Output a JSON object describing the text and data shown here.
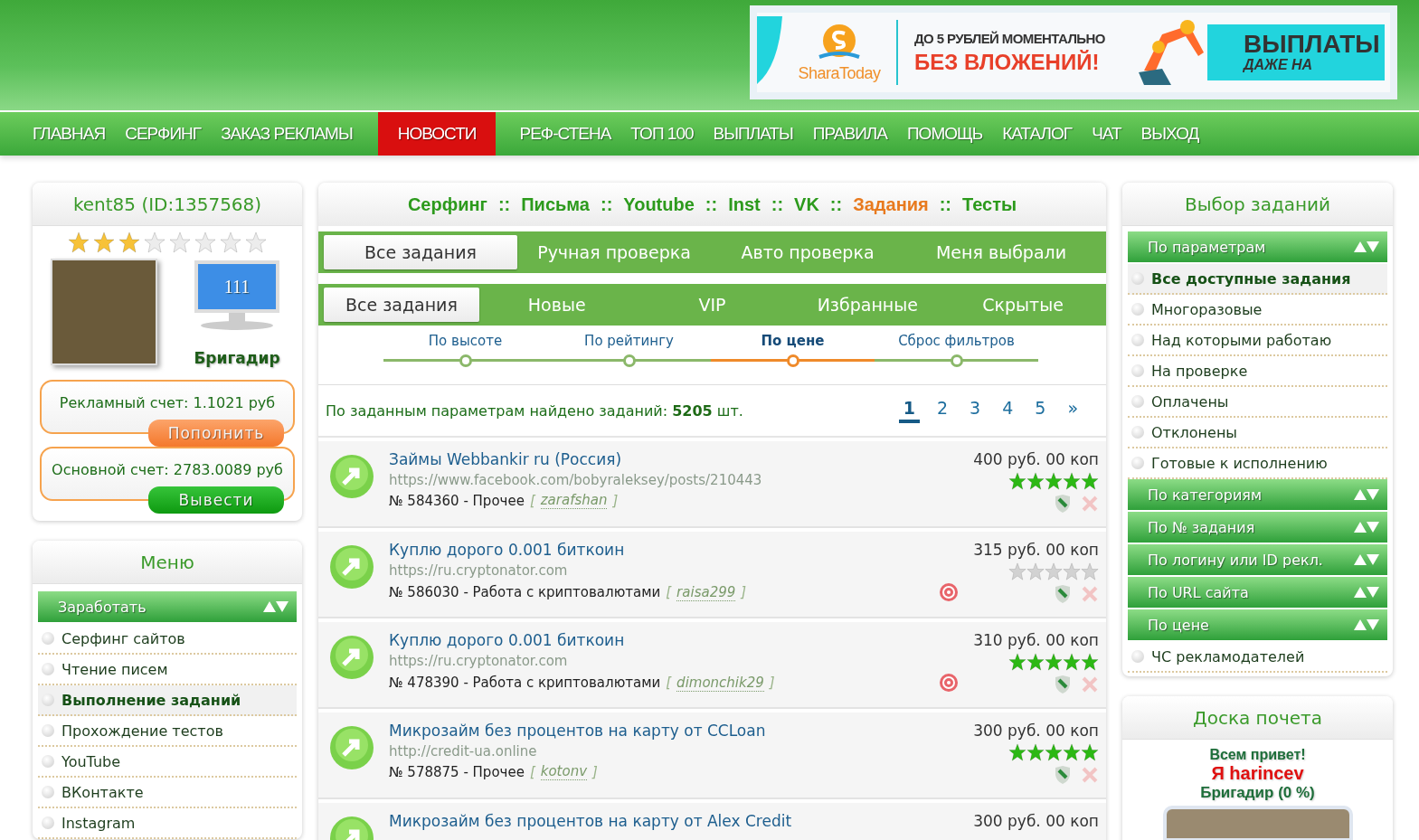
{
  "banner": {
    "logo": "SharaToday",
    "line_1": "ДО 5 РУБЛЕЙ МОМЕНТАЛЬНО",
    "line_2": "БЕЗ ВЛОЖЕНИЙ!",
    "headline": "ВЫПЛАТЫ",
    "subline": "ДАЖЕ НА"
  },
  "nav": [
    {
      "label": "ГЛАВНАЯ",
      "selected": false
    },
    {
      "label": "СЕРФИНГ",
      "selected": false
    },
    {
      "label": "ЗАКАЗ РЕКЛАМЫ",
      "selected": false
    },
    {
      "label": "НОВОСТИ",
      "selected": true
    },
    {
      "label": "РЕФ-СТЕНА",
      "selected": false
    },
    {
      "label": "ТОП 100",
      "selected": false
    },
    {
      "label": "ВЫПЛАТЫ",
      "selected": false
    },
    {
      "label": "ПРАВИЛА",
      "selected": false
    },
    {
      "label": "ПОМОЩЬ",
      "selected": false
    },
    {
      "label": "КАТАЛОГ",
      "selected": false
    },
    {
      "label": "ЧАТ",
      "selected": false
    },
    {
      "label": "ВЫХОД",
      "selected": false
    }
  ],
  "profile": {
    "title": "kent85 (ID:1357568)",
    "stars": 3,
    "level": "111",
    "rank": "Бригадир",
    "accounts": [
      {
        "label": "Рекламный счет: 1.1021 руб",
        "button": "Пополнить",
        "kind": "topup"
      },
      {
        "label": "Основной счет: 2783.0089 руб",
        "button": "Вывести",
        "kind": "withdraw"
      }
    ]
  },
  "menu": {
    "title": "Меню",
    "section": "Заработать",
    "items": [
      {
        "label": "Серфинг сайтов",
        "selected": false
      },
      {
        "label": "Чтение писем",
        "selected": false
      },
      {
        "label": "Выполнение заданий",
        "selected": true
      },
      {
        "label": "Прохождение тестов",
        "selected": false
      },
      {
        "label": "YouTube",
        "selected": false
      },
      {
        "label": "ВКонтакте",
        "selected": false
      },
      {
        "label": "Instagram",
        "selected": false
      }
    ]
  },
  "top_links": {
    "separator": "::",
    "items": [
      {
        "label": "Серфинг",
        "selected": false
      },
      {
        "label": "Письма",
        "selected": false
      },
      {
        "label": "Youtube",
        "selected": false
      },
      {
        "label": "Inst",
        "selected": false
      },
      {
        "label": "VK",
        "selected": false
      },
      {
        "label": "Задания",
        "selected": true
      },
      {
        "label": "Тесты",
        "selected": false
      }
    ]
  },
  "check_tabs": [
    {
      "label": "Все задания",
      "selected": true
    },
    {
      "label": "Ручная проверка",
      "selected": false
    },
    {
      "label": "Авто проверка",
      "selected": false
    },
    {
      "label": "Меня выбрали",
      "selected": false
    }
  ],
  "type_tabs": [
    {
      "label": "Все задания",
      "selected": true
    },
    {
      "label": "Новые",
      "selected": false
    },
    {
      "label": "VIP",
      "selected": false
    },
    {
      "label": "Избранные",
      "selected": false
    },
    {
      "label": "Скрытые",
      "selected": false
    }
  ],
  "sort": [
    {
      "label": "По высоте",
      "selected": false
    },
    {
      "label": "По рейтингу",
      "selected": false
    },
    {
      "label": "По цене",
      "selected": true
    },
    {
      "label": "Сброс фильтров",
      "selected": false
    }
  ],
  "found_text": "По заданным параметрам найдено заданий: **5205** шт.",
  "pages": [
    {
      "label": "1",
      "selected": true
    },
    {
      "label": "2",
      "selected": false
    },
    {
      "label": "3",
      "selected": false
    },
    {
      "label": "4",
      "selected": false
    },
    {
      "label": "5",
      "selected": false
    },
    {
      "label": "»",
      "selected": false
    }
  ],
  "author_open": "[",
  "author_close": "]",
  "tasks": [
    {
      "title": "Займы Webbankir ru (Россия)",
      "url": "https://www.facebook.com/bobyraleksey/posts/210443",
      "meta": "№ 584360 - Прочее",
      "author": "zarafshan",
      "price": "400 руб. 00 коп",
      "stars": 5,
      "target": false
    },
    {
      "title": "Куплю дорого 0.001 биткоин",
      "url": "https://ru.cryptonator.com",
      "meta": "№ 586030 - Работа с криптовалютами",
      "author": "raisa299",
      "price": "315 руб. 00 коп",
      "stars": 0,
      "target": true
    },
    {
      "title": "Куплю дорого 0.001 биткоин",
      "url": "https://ru.cryptonator.com",
      "meta": "№ 478390 - Работа с криптовалютами",
      "author": "dimonchik29",
      "price": "310 руб. 00 коп",
      "stars": 5,
      "target": true
    },
    {
      "title": "Микрозайм без процентов на карту от CCLoan",
      "url": "http://credit-ua.online",
      "meta": "№ 578875 - Прочее",
      "author": "kotonv",
      "price": "300 руб. 00 коп",
      "stars": 5,
      "target": false
    },
    {
      "title": "Микрозайм без процентов на карту от Alex Credit",
      "price": "300 руб. 00 коп"
    }
  ],
  "filters": {
    "title": "Выбор заданий",
    "rows": [
      {
        "kind": "header",
        "label": "По параметрам"
      },
      {
        "kind": "item",
        "label": "Все доступные задания",
        "selected": true
      },
      {
        "kind": "item",
        "label": "Многоразовые",
        "selected": false
      },
      {
        "kind": "item",
        "label": "Над которыми работаю",
        "selected": false
      },
      {
        "kind": "item",
        "label": "На проверке",
        "selected": false
      },
      {
        "kind": "item",
        "label": "Оплачены",
        "selected": false
      },
      {
        "kind": "item",
        "label": "Отклонены",
        "selected": false
      },
      {
        "kind": "item",
        "label": "Готовые к исполнению",
        "selected": false
      },
      {
        "kind": "header",
        "label": "По категориям"
      },
      {
        "kind": "header",
        "label": "По № задания"
      },
      {
        "kind": "header",
        "label": "По логину или ID рекл."
      },
      {
        "kind": "header",
        "label": "По URL сайта"
      },
      {
        "kind": "header",
        "label": "По цене"
      },
      {
        "kind": "item",
        "label": "ЧС рекламодателей",
        "selected": false
      }
    ]
  },
  "honor": {
    "title": "Доска почета",
    "greeting": "Всем привет!",
    "name": "Я harincev",
    "rank": "Бригадир (0 %)"
  }
}
